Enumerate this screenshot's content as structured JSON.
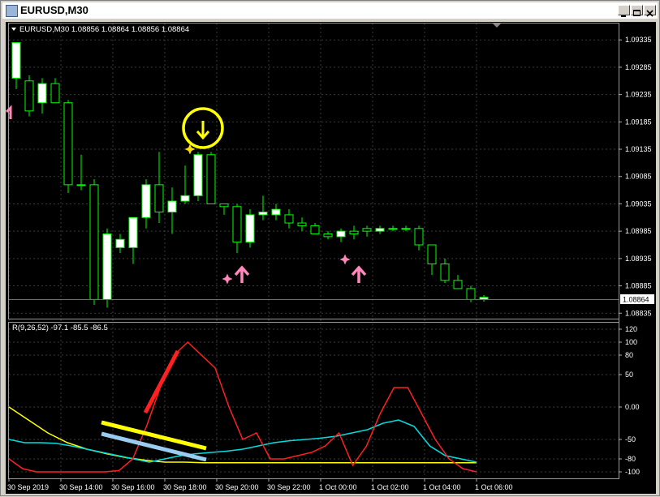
{
  "window": {
    "title": "EURUSD,M30"
  },
  "chart_header": "EURUSD,M30  1.08856 1.08864 1.08856 1.08864",
  "indicator_header": "R(9,26,52) -97.1 -85.5 -86.5",
  "current_price_label": "1.08864",
  "price_ticks": [
    "1.09335",
    "1.09285",
    "1.09235",
    "1.09185",
    "1.09135",
    "1.09085",
    "1.09035",
    "1.08985",
    "1.08935",
    "1.08885",
    "1.08835"
  ],
  "indicator_ticks": [
    "120",
    "100",
    "80",
    "50",
    "0.00",
    "-50",
    "-80",
    "-100"
  ],
  "time_ticks": [
    "30 Sep 2019",
    "30 Sep 14:00",
    "30 Sep 16:00",
    "30 Sep 18:00",
    "30 Sep 20:00",
    "30 Sep 22:00",
    "1 Oct 00:00",
    "1 Oct 02:00",
    "1 Oct 04:00",
    "1 Oct 06:00"
  ],
  "colors": {
    "bg": "#000000",
    "grid": "#3a3a3a",
    "bull_candle": "#ffffff",
    "wick": "#00ff00",
    "signal": "#ffff00",
    "buy_arrow": "#ff88bb",
    "fast_line": "#ff2020",
    "mid_line": "#00dddd",
    "slow_line": "#ffff00",
    "trend_light": "#99ccee"
  },
  "icons": [
    "dropdown-triangle-icon",
    "sell-arrow-icon",
    "buy-arrow-icon",
    "star-icon",
    "minimize-icon",
    "maximize-icon",
    "close-icon"
  ],
  "chart_data": {
    "type": "candlestick",
    "symbol": "EURUSD",
    "timeframe": "M30",
    "ylim": [
      1.08825,
      1.09365
    ],
    "candles": [
      {
        "o": 1.09265,
        "h": 1.0933,
        "l": 1.09245,
        "c": 1.0933
      },
      {
        "o": 1.0926,
        "h": 1.0927,
        "l": 1.09195,
        "c": 1.09205
      },
      {
        "o": 1.0922,
        "h": 1.09265,
        "l": 1.092,
        "c": 1.09255
      },
      {
        "o": 1.09255,
        "h": 1.09265,
        "l": 1.0922,
        "c": 1.0922
      },
      {
        "o": 1.0922,
        "h": 1.09225,
        "l": 1.09055,
        "c": 1.0907
      },
      {
        "o": 1.0907,
        "h": 1.09125,
        "l": 1.0906,
        "c": 1.0907
      },
      {
        "o": 1.0907,
        "h": 1.0908,
        "l": 1.0885,
        "c": 1.0886
      },
      {
        "o": 1.0886,
        "h": 1.0899,
        "l": 1.08845,
        "c": 1.0898
      },
      {
        "o": 1.08955,
        "h": 1.0898,
        "l": 1.08945,
        "c": 1.0897
      },
      {
        "o": 1.08955,
        "h": 1.0901,
        "l": 1.08925,
        "c": 1.0901
      },
      {
        "o": 1.0901,
        "h": 1.0908,
        "l": 1.0899,
        "c": 1.0907
      },
      {
        "o": 1.0907,
        "h": 1.0913,
        "l": 1.09,
        "c": 1.0902
      },
      {
        "o": 1.0902,
        "h": 1.09065,
        "l": 1.0898,
        "c": 1.0904
      },
      {
        "o": 1.0904,
        "h": 1.09105,
        "l": 1.09035,
        "c": 1.0905
      },
      {
        "o": 1.0905,
        "h": 1.0913,
        "l": 1.0904,
        "c": 1.09125
      },
      {
        "o": 1.09125,
        "h": 1.0913,
        "l": 1.09035,
        "c": 1.09035
      },
      {
        "o": 1.09035,
        "h": 1.09035,
        "l": 1.09015,
        "c": 1.0903
      },
      {
        "o": 1.0903,
        "h": 1.09035,
        "l": 1.08945,
        "c": 1.08965
      },
      {
        "o": 1.08965,
        "h": 1.09025,
        "l": 1.08955,
        "c": 1.09015
      },
      {
        "o": 1.09015,
        "h": 1.0905,
        "l": 1.09005,
        "c": 1.0902
      },
      {
        "o": 1.09015,
        "h": 1.09035,
        "l": 1.09005,
        "c": 1.09025
      },
      {
        "o": 1.09015,
        "h": 1.09025,
        "l": 1.0899,
        "c": 1.09
      },
      {
        "o": 1.09,
        "h": 1.0901,
        "l": 1.08985,
        "c": 1.08995
      },
      {
        "o": 1.08995,
        "h": 1.09,
        "l": 1.0898,
        "c": 1.0898
      },
      {
        "o": 1.0898,
        "h": 1.08985,
        "l": 1.0897,
        "c": 1.08975
      },
      {
        "o": 1.08975,
        "h": 1.0899,
        "l": 1.08965,
        "c": 1.08985
      },
      {
        "o": 1.08985,
        "h": 1.08995,
        "l": 1.0897,
        "c": 1.0898
      },
      {
        "o": 1.0899,
        "h": 1.08995,
        "l": 1.08975,
        "c": 1.08985
      },
      {
        "o": 1.08985,
        "h": 1.08995,
        "l": 1.0898,
        "c": 1.0899
      },
      {
        "o": 1.0899,
        "h": 1.08995,
        "l": 1.08985,
        "c": 1.0899
      },
      {
        "o": 1.0899,
        "h": 1.08995,
        "l": 1.08985,
        "c": 1.0899
      },
      {
        "o": 1.0899,
        "h": 1.08995,
        "l": 1.0895,
        "c": 1.0896
      },
      {
        "o": 1.0896,
        "h": 1.0896,
        "l": 1.08905,
        "c": 1.08925
      },
      {
        "o": 1.08925,
        "h": 1.08935,
        "l": 1.0889,
        "c": 1.08895
      },
      {
        "o": 1.08895,
        "h": 1.08905,
        "l": 1.0888,
        "c": 1.0888
      },
      {
        "o": 1.0888,
        "h": 1.08885,
        "l": 1.08855,
        "c": 1.0886
      },
      {
        "o": 1.0886,
        "h": 1.08868,
        "l": 1.08856,
        "c": 1.08864
      }
    ],
    "indicator": {
      "name": "R(9,26,52)",
      "ylim": [
        -110,
        130
      ],
      "fast": [
        -80,
        -95,
        -100,
        -100,
        -100,
        -100,
        -100,
        -100,
        -98,
        -80,
        -30,
        30,
        80,
        100,
        80,
        60,
        0,
        -50,
        -40,
        -80,
        -80,
        -75,
        -70,
        -60,
        -40,
        -90,
        -60,
        -10,
        30,
        30,
        -10,
        -50,
        -80,
        -95,
        -100
      ],
      "mid": [
        -50,
        -55,
        -55,
        -56,
        -60,
        -65,
        -70,
        -75,
        -80,
        -85,
        -80,
        -75,
        -72,
        -70,
        -68,
        -65,
        -60,
        -55,
        -52,
        -50,
        -48,
        -45,
        -40,
        -35,
        -25,
        -20,
        -30,
        -60,
        -75,
        -80,
        -85
      ],
      "slow": [
        0,
        -20,
        -40,
        -55,
        -65,
        -72,
        -78,
        -82,
        -85,
        -85,
        -86,
        -86,
        -86,
        -86,
        -86,
        -86,
        -86,
        -86,
        -86,
        -86,
        -86,
        -86,
        -86,
        -86,
        -86
      ]
    }
  }
}
